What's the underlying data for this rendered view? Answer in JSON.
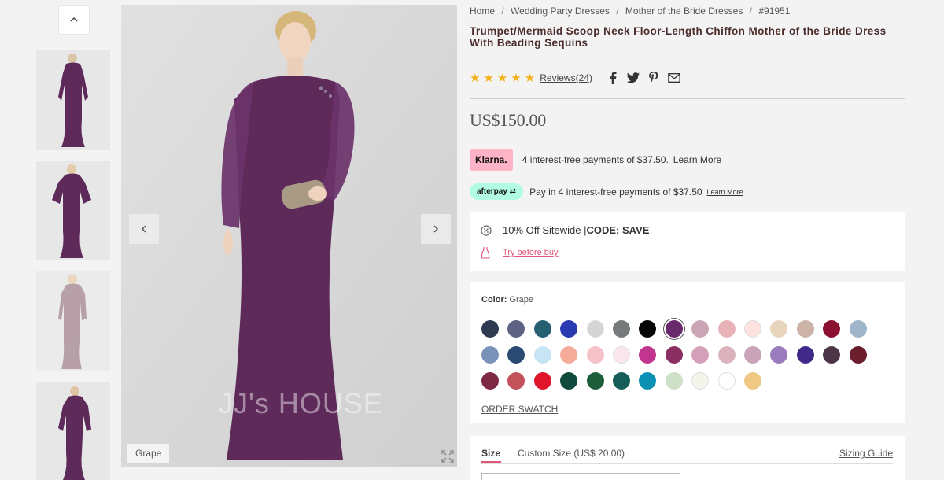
{
  "thumbnails": {
    "up_icon": "chevron-up-icon",
    "items": [
      {
        "alt": "back view"
      },
      {
        "alt": "front view"
      },
      {
        "alt": "light mauve view"
      },
      {
        "alt": "side view"
      }
    ]
  },
  "gallery": {
    "watermark": "JJ's HOUSE",
    "color_tag": "Grape",
    "prev_icon": "chevron-left-icon",
    "next_icon": "chevron-right-icon",
    "zoom_icon": "expand-icon",
    "dress_color": "#5e2a5a"
  },
  "breadcrumb": {
    "items": [
      "Home",
      "Wedding Party Dresses",
      "Mother of the Bride Dresses",
      "#91951"
    ],
    "separator": "/"
  },
  "product": {
    "title": "Trumpet/Mermaid Scoop Neck Floor-Length Chiffon Mother of the Bride Dress With Beading Sequins",
    "stars": "★★★★★",
    "reviews_label": "Reviews(24)",
    "social": [
      "facebook-icon",
      "twitter-icon",
      "pinterest-icon",
      "email-icon"
    ],
    "price": "US$150.00"
  },
  "payments": {
    "klarna_logo": "Klarna.",
    "klarna_text": "4 interest-free payments of $37.50.",
    "klarna_link": "Learn More",
    "afterpay_logo": "afterpay",
    "afterpay_text": "Pay in 4 interest-free payments of $37.50",
    "afterpay_link": "Learn More"
  },
  "promo": {
    "sitewide": "10% Off Sitewide | ",
    "code": "CODE: SAVE",
    "try_label": "Try before buy"
  },
  "color": {
    "label": "Color:",
    "selected": "Grape",
    "order_swatch": "ORDER SWATCH",
    "swatches": [
      [
        "#2d3a4f",
        "#5d6285",
        "#275f73",
        "#2a3ab0",
        "#d5d5d5",
        "#767a7a",
        "#050505",
        "#6a2a6e",
        "#cba5b6",
        "#e8b3b8",
        "#fde3df",
        "#e8d5bd",
        "#cdb2a8",
        "#8c1030",
        "#9fb5ca"
      ],
      [
        "#7993b8",
        "#2b4a73",
        "#c7e4f5",
        "#f5ab9a",
        "#f4c2c7",
        "#fbe6ee",
        "#c2358f",
        "#8b2e62",
        "#d4a0b9",
        "#dcb3bd",
        "#c9a3b8",
        "#9b7dbd",
        "#3f2a8a",
        "#4d3548",
        "#6b1f2e"
      ],
      [
        "#7e2a45",
        "#c4525b",
        "#e0142a",
        "#0f4a3c",
        "#1d5e3a",
        "#155e58",
        "#0b91b4",
        "#cfe0c8",
        "#f3f5ea",
        "#ffffff",
        "#efc983"
      ]
    ]
  },
  "size": {
    "tab_label": "Size",
    "custom_size": "Custom Size (US$ 20.00)",
    "guide_label": "Sizing Guide"
  }
}
